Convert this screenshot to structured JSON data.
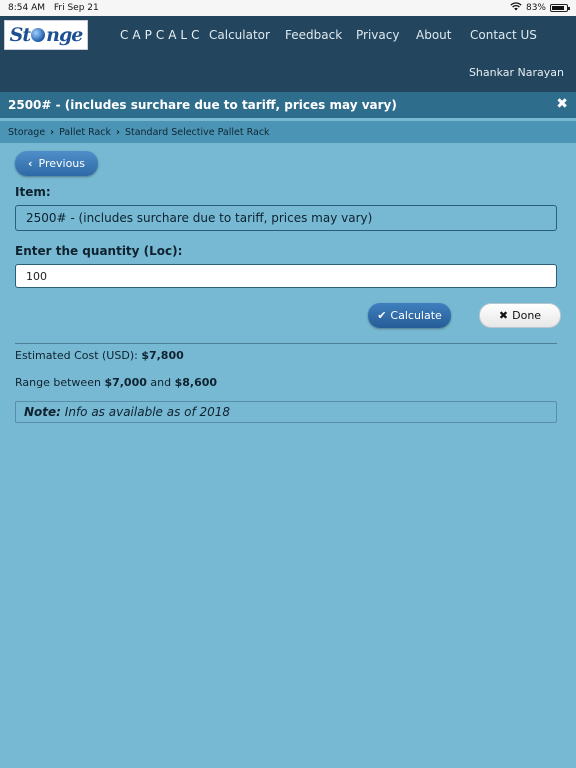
{
  "status": {
    "time": "8:54 AM",
    "date": "Fri Sep 21",
    "battery": "83%"
  },
  "header": {
    "brand": "CAPCALC",
    "nav": [
      "Calculator",
      "Feedback",
      "Privacy",
      "About",
      "Contact US"
    ],
    "user": "Shankar Narayan"
  },
  "title": {
    "text": "2500# - (includes surchare due to tariff, prices may vary)",
    "close_icon": "close-icon"
  },
  "breadcrumb": [
    "Storage",
    "Pallet Rack",
    "Standard Selective Pallet Rack"
  ],
  "form": {
    "previous_label": "Previous",
    "item_label": "Item:",
    "item_value": "2500# - (includes surchare due to tariff, prices may vary)",
    "quantity_label": "Enter the quantity (Loc):",
    "quantity_value": "100",
    "calculate_label": "Calculate",
    "done_label": "Done"
  },
  "result": {
    "estimated_prefix": "Estimated Cost (USD):",
    "estimated_value": "$7,800",
    "range_prefix": "Range between",
    "range_low": "$7,000",
    "range_and": "and",
    "range_high": "$8,600",
    "note_label": "Note:",
    "note_text": "Info as available as of 2018"
  }
}
